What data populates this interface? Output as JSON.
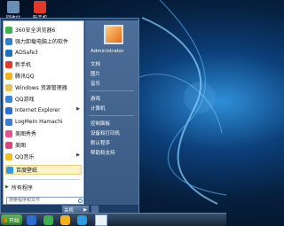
{
  "desktop": {
    "icons": [
      {
        "label": "回收站",
        "color": "#6a8fb5"
      },
      {
        "label": "新手机",
        "color": "#e23a2a"
      }
    ]
  },
  "start_menu": {
    "programs": [
      {
        "label": "360安全浏览器6",
        "icon_color": "#3bb34a",
        "arrow": false
      },
      {
        "label": "强力卸载电脑上的软件",
        "icon_color": "#2f7fd0",
        "arrow": false
      },
      {
        "label": "ADSafe3",
        "icon_color": "#1f6fc4",
        "arrow": false
      },
      {
        "label": "新手机",
        "icon_color": "#e23a2a",
        "arrow": false
      },
      {
        "label": "腾讯QQ",
        "icon_color": "#f2b31b",
        "arrow": false
      },
      {
        "label": "Windows 资源管理器",
        "icon_color": "#e9c25a",
        "arrow": false
      },
      {
        "label": "QQ游戏",
        "icon_color": "#3a86d6",
        "arrow": false
      },
      {
        "label": "Internet Explorer",
        "icon_color": "#2c6fd1",
        "arrow": true
      },
      {
        "label": "LogMeIn Hamachi",
        "icon_color": "#3a7bd5",
        "arrow": false
      },
      {
        "label": "美图秀秀",
        "icon_color": "#e8508e",
        "arrow": false
      },
      {
        "label": "美图",
        "icon_color": "#d44a7e",
        "arrow": false
      },
      {
        "label": "QQ音乐",
        "icon_color": "#f0c020",
        "arrow": true
      },
      {
        "label": "百度壁纸",
        "icon_color": "#2f9be0",
        "arrow": false
      }
    ],
    "highlighted_index": 12,
    "all_programs": "所有程序",
    "search_placeholder": "搜索程序和文件",
    "user": "Administrator",
    "right_items_1": [
      "文档",
      "图片",
      "音乐"
    ],
    "right_items_2": [
      "游戏",
      "计算机"
    ],
    "right_items_3": [
      "控制面板",
      "设备和打印机",
      "默认程序",
      "帮助和支持"
    ],
    "shutdown_label": "关机"
  },
  "taskbar": {
    "start_label": "开始",
    "icons": [
      {
        "name": "ie-taskbar-icon",
        "color": "#2c6fd1"
      },
      {
        "name": "browser-taskbar-icon",
        "color": "#3bb34a"
      },
      {
        "name": "qq-taskbar-icon",
        "color": "#f2b31b"
      },
      {
        "name": "refresh-taskbar-icon",
        "color": "#2f9be0"
      }
    ]
  }
}
